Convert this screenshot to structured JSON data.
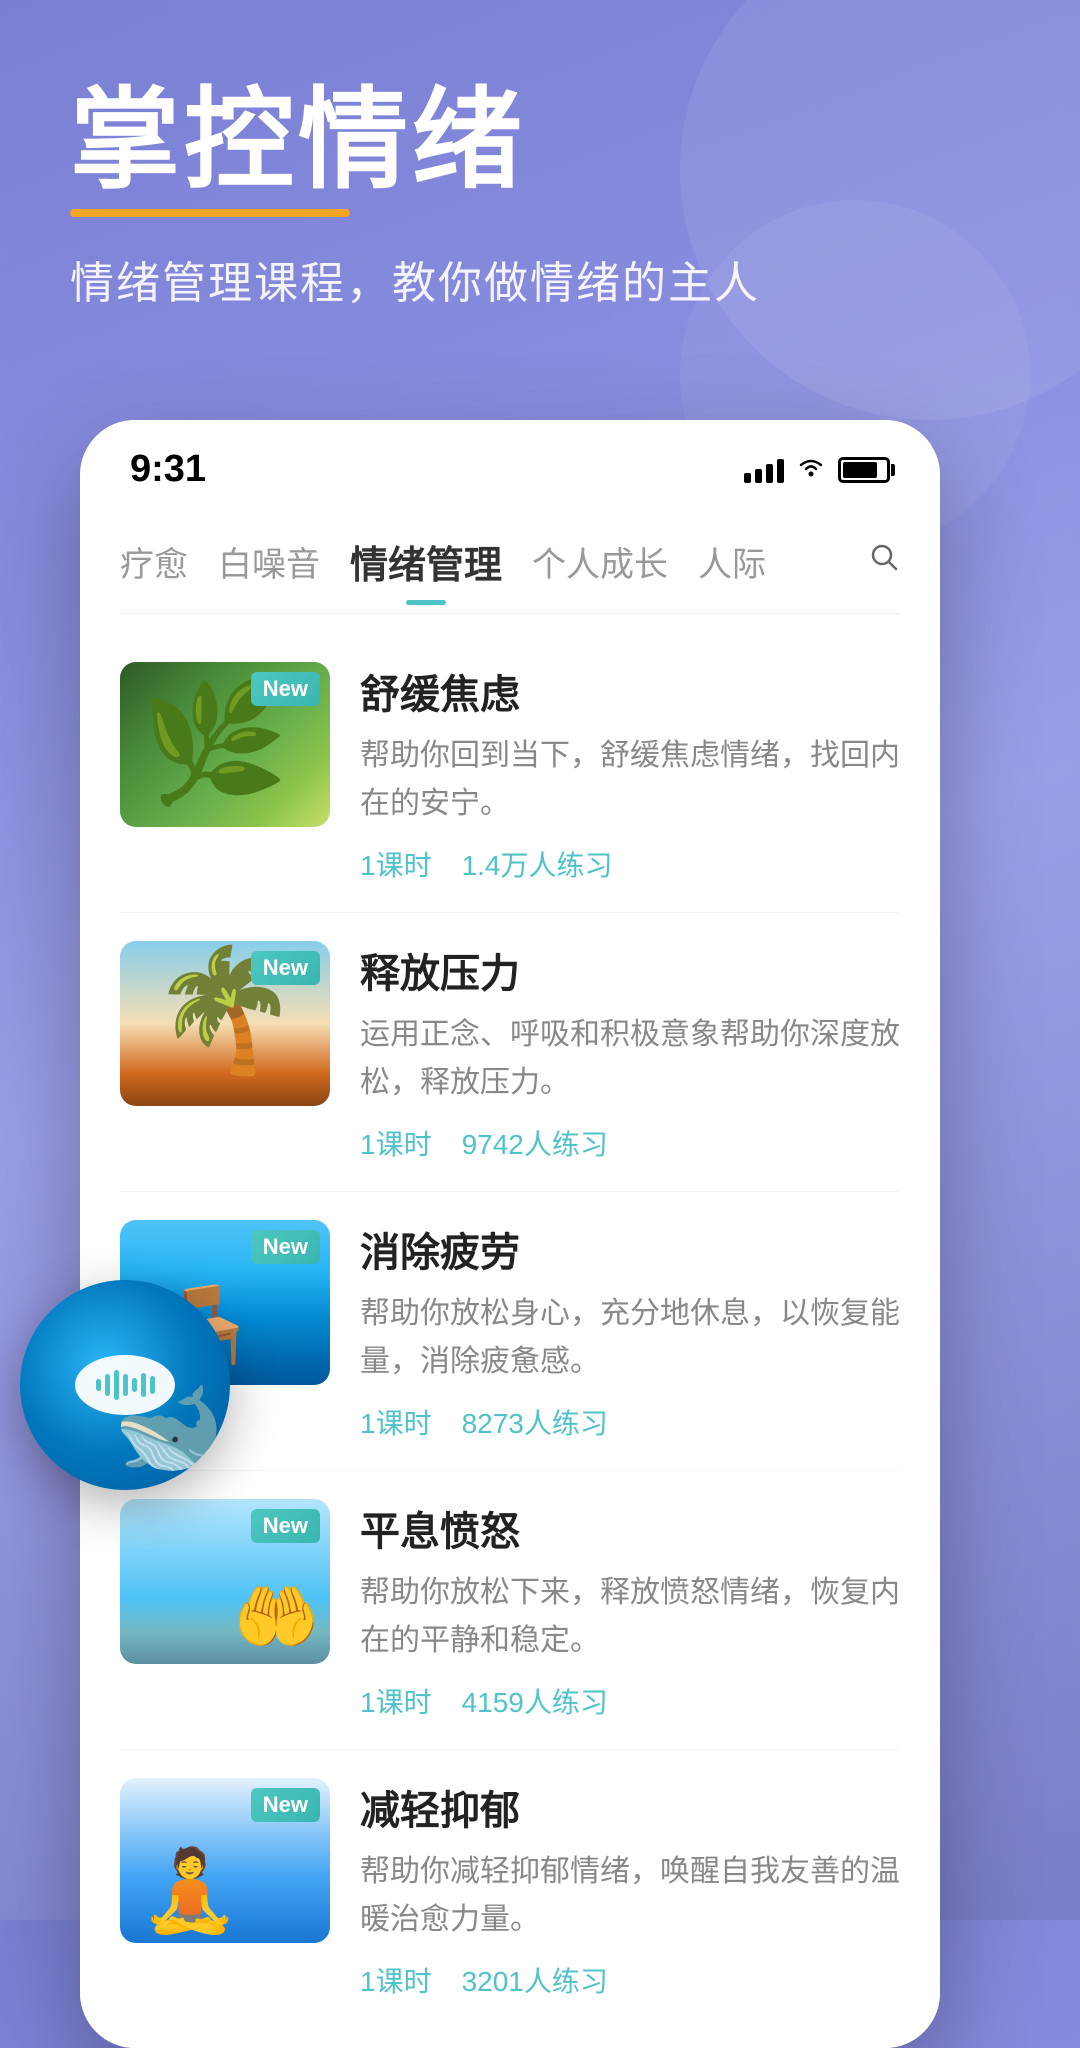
{
  "background": {
    "gradient_start": "#7b7fd4",
    "gradient_end": "#7a7ec8"
  },
  "header": {
    "title": "掌控情绪",
    "subtitle": "情绪管理课程，教你做情绪的主人",
    "underline_color": "#f5a623"
  },
  "status_bar": {
    "time": "9:31"
  },
  "nav": {
    "tabs": [
      {
        "label": "疗愈",
        "active": false
      },
      {
        "label": "白噪音",
        "active": false
      },
      {
        "label": "情绪管理",
        "active": true
      },
      {
        "label": "个人成长",
        "active": false
      },
      {
        "label": "人际",
        "active": false
      }
    ]
  },
  "courses": [
    {
      "id": 1,
      "title": "舒缓焦虑",
      "description": "帮助你回到当下，舒缓焦虑情绪，找回内在的安宁。",
      "lessons": "1课时",
      "participants": "1.4万人练习",
      "is_new": true,
      "new_label": "New",
      "thumb_class": "thumb-1"
    },
    {
      "id": 2,
      "title": "释放压力",
      "description": "运用正念、呼吸和积极意象帮助你深度放松，释放压力。",
      "lessons": "1课时",
      "participants": "9742人练习",
      "is_new": true,
      "new_label": "New",
      "thumb_class": "thumb-2"
    },
    {
      "id": 3,
      "title": "消除疲劳",
      "description": "帮助你放松身心，充分地休息，以恢复能量，消除疲惫感。",
      "lessons": "1课时",
      "participants": "8273人练习",
      "is_new": true,
      "new_label": "New",
      "thumb_class": "thumb-3"
    },
    {
      "id": 4,
      "title": "平息愤怒",
      "description": "帮助你放松下来，释放愤怒情绪，恢复内在的平静和稳定。",
      "lessons": "1课时",
      "participants": "4159人练习",
      "is_new": true,
      "new_label": "New",
      "thumb_class": "thumb-4"
    },
    {
      "id": 5,
      "title": "减轻抑郁",
      "description": "帮助你减轻抑郁情绪，唤醒自我友善的温暖治愈力量。",
      "lessons": "1课时",
      "participants": "3201人练习",
      "is_new": true,
      "new_label": "New",
      "thumb_class": "thumb-5"
    }
  ]
}
